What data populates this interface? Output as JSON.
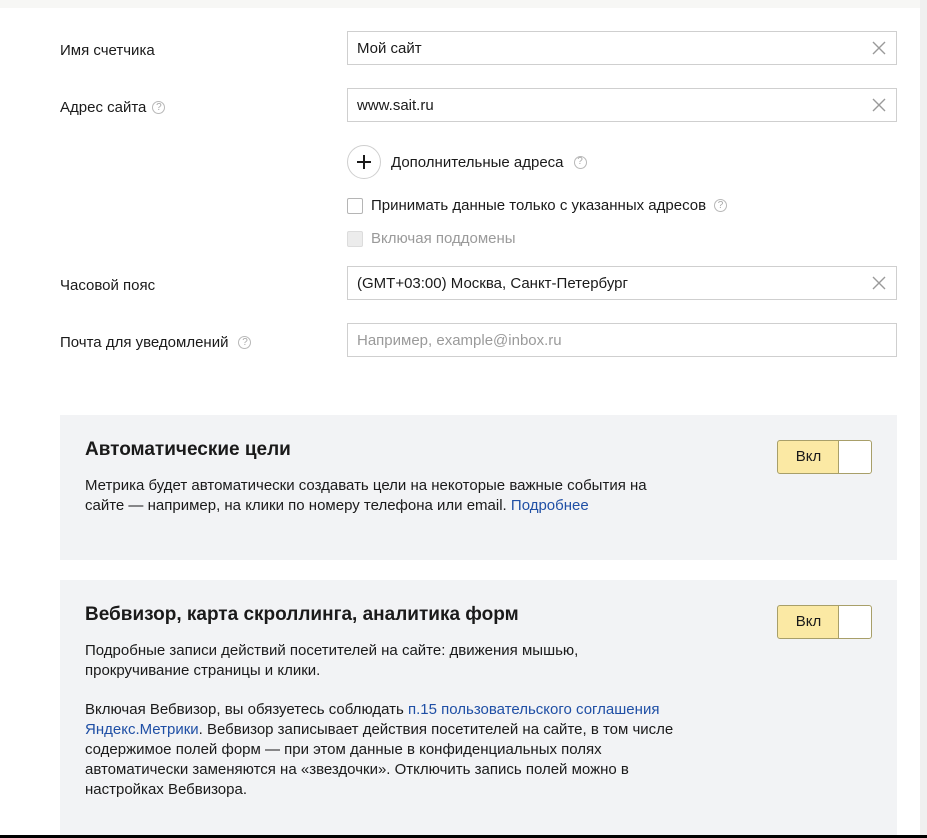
{
  "form": {
    "counter_name": {
      "label": "Имя счетчика",
      "value": "Мой сайт"
    },
    "site_address": {
      "label": "Адрес сайта",
      "value": "www.sait.ru"
    },
    "additional_addresses_label": "Дополнительные адреса",
    "only_listed_label": "Принимать данные только с указанных адресов",
    "include_subdomains_label": "Включая поддомены",
    "timezone": {
      "label": "Часовой пояс",
      "value": "(GMT+03:00) Москва, Санкт-Петербург"
    },
    "notify_email": {
      "label": "Почта для уведомлений",
      "placeholder": "Например, example@inbox.ru"
    }
  },
  "help_glyph": "?",
  "auto_goals": {
    "title": "Автоматические цели",
    "desc_line1": "Метрика будет автоматически создавать цели на некоторые важные события на",
    "desc_line2": "сайте — например, на клики по номеру телефона или email.",
    "more_link": "Подробнее",
    "toggle_label": "Вкл"
  },
  "webvisor": {
    "title": "Вебвизор, карта скроллинга, аналитика форм",
    "desc_line1": "Подробные записи действий посетителей на сайте: движения мышью,",
    "desc_line2": "прокручивание страницы и клики.",
    "notice_part1": "Включая Вебвизор, вы обязуетесь соблюдать",
    "notice_link_a": "п.15 пользовательского соглашения",
    "notice_link_b": "Яндекс.Метрики",
    "notice_part2": ". Вебвизор записывает действия посетителей на сайте, в том числе",
    "notice_line3": "содержимое полей форм — при этом данные в конфиденциальных полях",
    "notice_line4": "автоматически заменяются на «звездочки». Отключить запись полей можно в",
    "notice_line5": "настройках Вебвизора.",
    "toggle_label": "Вкл"
  },
  "colors": {
    "toggle_on_bg": "#fbe9a4",
    "link": "#1f4fa5",
    "panel_bg": "#f2f3f5"
  },
  "icons": [
    "help-icon",
    "clear-icon",
    "plus-icon"
  ]
}
